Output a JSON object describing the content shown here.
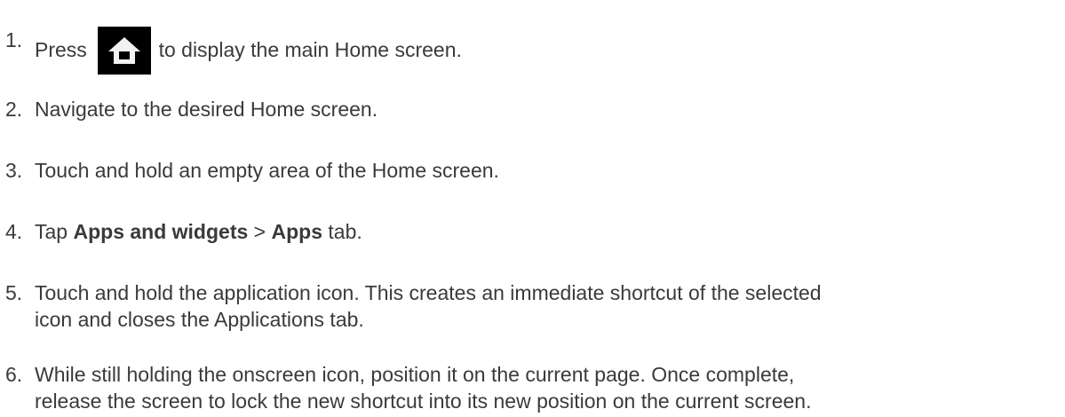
{
  "steps": [
    {
      "number": "1.",
      "before": "Press",
      "icon": "home-key-icon",
      "after": "to display the main Home screen."
    },
    {
      "number": "2.",
      "text": "Navigate to the desired Home screen."
    },
    {
      "number": "3.",
      "text": "Touch and hold an empty area of the Home screen."
    },
    {
      "number": "4.",
      "pre": "Tap",
      "bold1": "Apps and widgets",
      "sep": ">",
      "bold2": "Apps",
      "post": "tab."
    },
    {
      "number": "5.",
      "line1": "Touch and hold the application icon. This creates an immediate shortcut of the selected",
      "line2": "icon and closes the Applications tab."
    },
    {
      "number": "6.",
      "line1": "While still holding the onscreen icon, position it on the current page. Once complete,",
      "line2": "release the screen to lock the new shortcut into its new position on the current screen."
    }
  ],
  "colors": {
    "text": "#3a3a3a",
    "icon_bg": "#000000",
    "icon_fg": "#f2f2f2"
  }
}
